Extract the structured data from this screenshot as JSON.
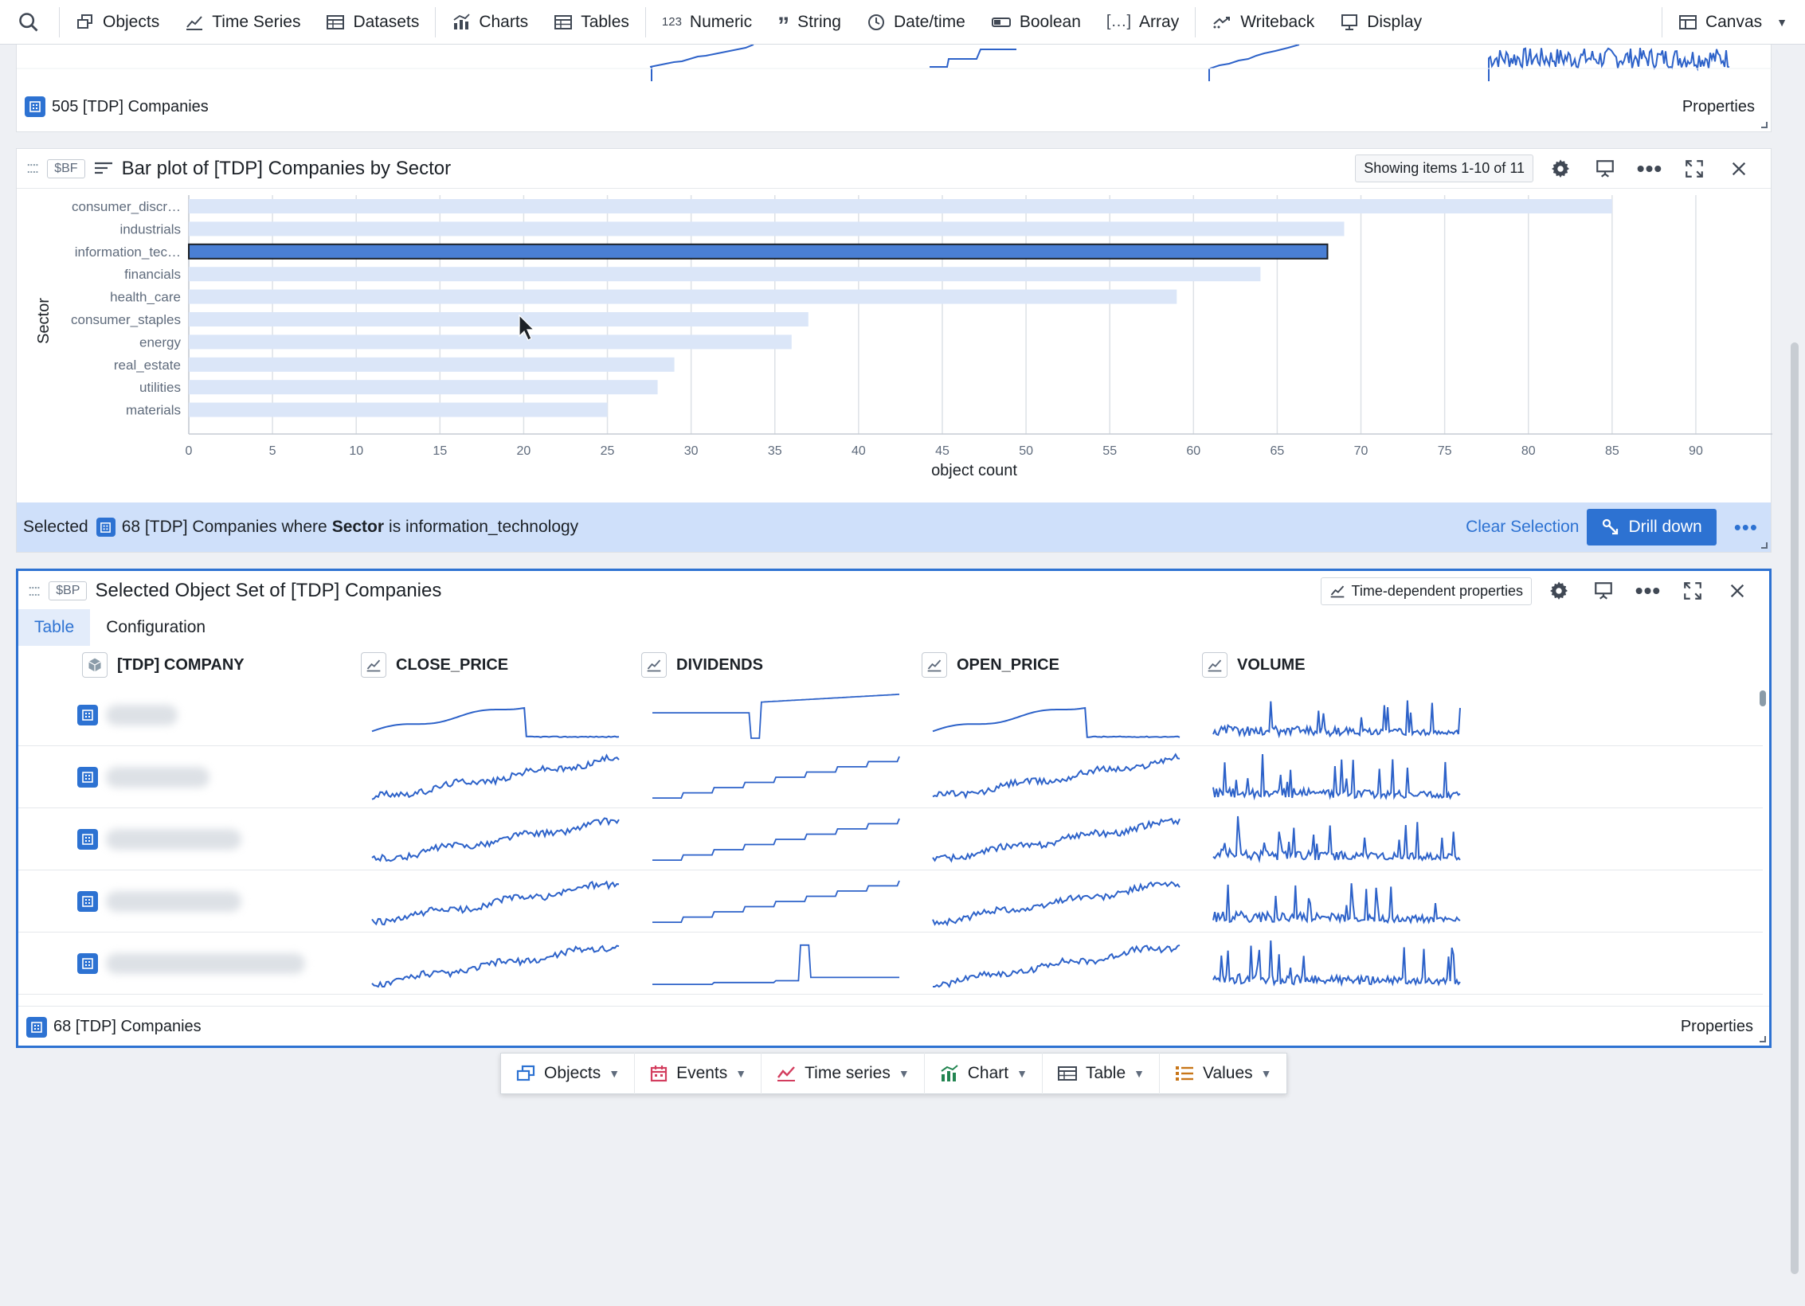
{
  "toolbar": {
    "items": [
      {
        "label": "Objects",
        "icon": "cube-stack-icon"
      },
      {
        "label": "Time Series",
        "icon": "timeline-icon"
      },
      {
        "label": "Datasets",
        "icon": "dataset-icon"
      },
      {
        "label": "Charts",
        "icon": "chart-icon"
      },
      {
        "label": "Tables",
        "icon": "table-icon"
      },
      {
        "label": "Numeric",
        "icon": "numeric-icon"
      },
      {
        "label": "String",
        "icon": "quote-icon"
      },
      {
        "label": "Date/time",
        "icon": "clock-icon"
      },
      {
        "label": "Boolean",
        "icon": "toggle-icon"
      },
      {
        "label": "Array",
        "icon": "array-icon"
      },
      {
        "label": "Writeback",
        "icon": "writeback-icon"
      },
      {
        "label": "Display",
        "icon": "display-icon"
      }
    ],
    "numeric_glyph": "123",
    "array_glyph": "[…]",
    "canvas_label": "Canvas"
  },
  "top_card": {
    "count_label": "505 [TDP] Companies",
    "properties_label": "Properties"
  },
  "bar_card": {
    "var_badge": "$BF",
    "title": "Bar plot of [TDP] Companies by Sector",
    "showing": "Showing items 1-10 of 11"
  },
  "chart_data": {
    "type": "bar",
    "orientation": "horizontal",
    "categories": [
      "consumer_discr…",
      "industrials",
      "information_tec…",
      "financials",
      "health_care",
      "consumer_staples",
      "energy",
      "real_estate",
      "utilities",
      "materials"
    ],
    "values": [
      85,
      69,
      68,
      64,
      59,
      37,
      36,
      29,
      28,
      25
    ],
    "selected_index": 2,
    "xlabel": "object count",
    "ylabel": "Sector",
    "xlim": [
      0,
      92
    ],
    "xticks": [
      0,
      5,
      10,
      15,
      20,
      25,
      30,
      35,
      40,
      45,
      50,
      55,
      60,
      65,
      70,
      75,
      80,
      85,
      90
    ],
    "grid": true,
    "bar_color": "#dbe6f8",
    "selected_color": "#4a7fd4"
  },
  "selection": {
    "prefix": "Selected",
    "before_bold": "68 [TDP] Companies where",
    "bold": "Sector",
    "after_bold": "is information_technology",
    "clear_label": "Clear Selection",
    "drill_label": "Drill down"
  },
  "object_card": {
    "var_badge": "$BP",
    "title": "Selected Object Set of [TDP] Companies",
    "time_dep_label": "Time-dependent properties",
    "tabs": [
      "Table",
      "Configuration"
    ],
    "columns": [
      "[TDP] COMPANY",
      "CLOSE_PRICE",
      "DIVIDENDS",
      "OPEN_PRICE",
      "VOLUME"
    ],
    "count_label": "68 [TDP] Companies",
    "properties_label": "Properties"
  },
  "dock": {
    "items": [
      {
        "label": "Objects",
        "icon": "objects-icon"
      },
      {
        "label": "Events",
        "icon": "calendar-icon"
      },
      {
        "label": "Time series",
        "icon": "timeseries-icon"
      },
      {
        "label": "Chart",
        "icon": "chart-icon"
      },
      {
        "label": "Table",
        "icon": "table-icon"
      },
      {
        "label": "Values",
        "icon": "list-icon"
      }
    ]
  },
  "colors": {
    "accent": "#2d72d2",
    "selection_bg": "#cfe0fa",
    "spark": "#2d62c9"
  }
}
